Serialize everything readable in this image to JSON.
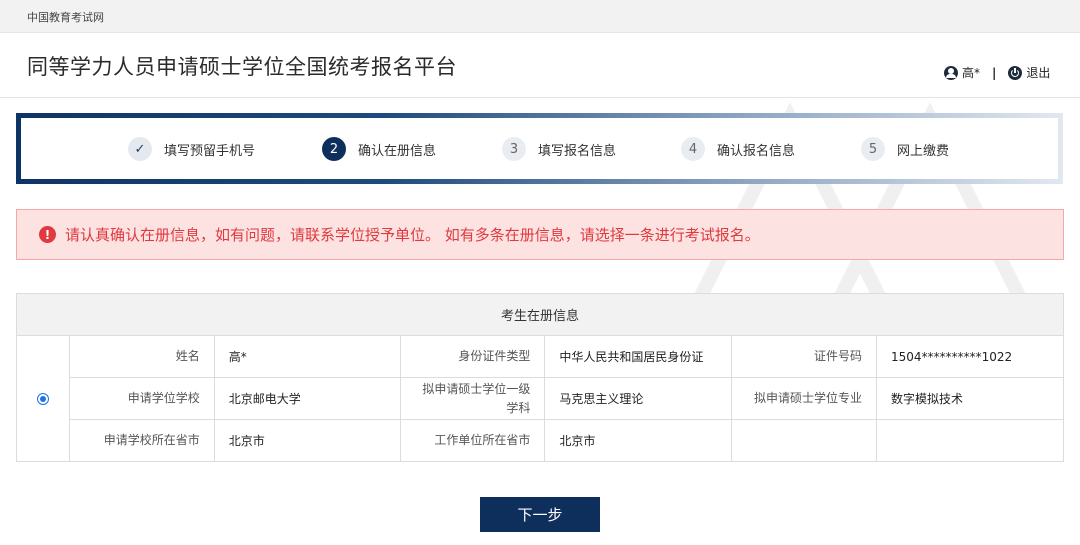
{
  "topbar": {
    "site_name": "中国教育考试网"
  },
  "header": {
    "title": "同等学力人员申请硕士学位全国统考报名平台",
    "user_name": "高*",
    "separator": "|",
    "logout_label": "退出"
  },
  "steps": [
    {
      "number": "✓",
      "label": "填写预留手机号",
      "state": "done"
    },
    {
      "number": "2",
      "label": "确认在册信息",
      "state": "active"
    },
    {
      "number": "3",
      "label": "填写报名信息",
      "state": "pending"
    },
    {
      "number": "4",
      "label": "确认报名信息",
      "state": "pending"
    },
    {
      "number": "5",
      "label": "网上缴费",
      "state": "pending"
    }
  ],
  "alert": {
    "icon": "!",
    "text": "请认真确认在册信息，如有问题，请联系学位授予单位。 如有多条在册信息，请选择一条进行考试报名。"
  },
  "table": {
    "header": "考生在册信息",
    "record": {
      "selected": true,
      "rows": [
        [
          {
            "label": "姓名",
            "value": "高*"
          },
          {
            "label": "身份证件类型",
            "value": "中华人民共和国居民身份证"
          },
          {
            "label": "证件号码",
            "value": "1504**********1022"
          }
        ],
        [
          {
            "label": "申请学位学校",
            "value": "北京邮电大学"
          },
          {
            "label": "拟申请硕士学位一级学科",
            "value": "马克思主义理论"
          },
          {
            "label": "拟申请硕士学位专业",
            "value": "数字模拟技术"
          }
        ],
        [
          {
            "label": "申请学校所在省市",
            "value": "北京市"
          },
          {
            "label": "工作单位所在省市",
            "value": "北京市"
          },
          {
            "label": "",
            "value": ""
          }
        ]
      ]
    }
  },
  "next_button": {
    "label": "下一步"
  },
  "colors": {
    "primary": "#0e2f5c",
    "alert_text": "#e0393e",
    "alert_bg": "#fde2e2",
    "radio": "#1a73e8"
  }
}
